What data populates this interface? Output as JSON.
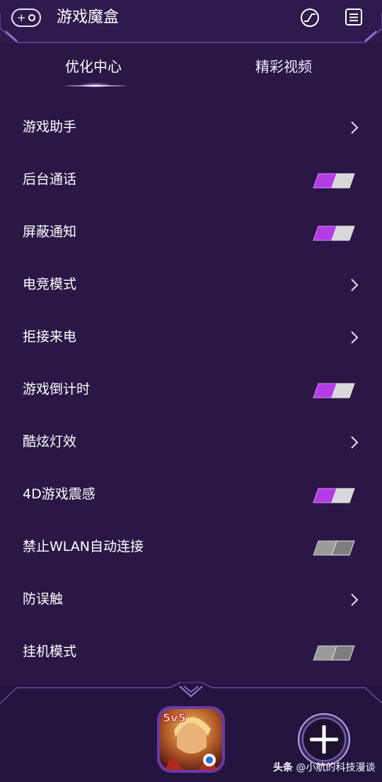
{
  "header": {
    "title": "游戏魔盒"
  },
  "tabs": [
    {
      "label": "优化中心",
      "active": true
    },
    {
      "label": "精彩视频",
      "active": false
    }
  ],
  "settings": [
    {
      "label": "游戏助手",
      "control": "chevron"
    },
    {
      "label": "后台通话",
      "control": "toggle",
      "on": true
    },
    {
      "label": "屏蔽通知",
      "control": "toggle",
      "on": true
    },
    {
      "label": "电竞模式",
      "control": "chevron"
    },
    {
      "label": "拒接来电",
      "control": "chevron"
    },
    {
      "label": "游戏倒计时",
      "control": "toggle",
      "on": true
    },
    {
      "label": "酷炫灯效",
      "control": "chevron"
    },
    {
      "label": "4D游戏震感",
      "control": "toggle",
      "on": true
    },
    {
      "label": "禁止WLAN自动连接",
      "control": "toggle",
      "on": false
    },
    {
      "label": "防误触",
      "control": "chevron"
    },
    {
      "label": "挂机模式",
      "control": "toggle",
      "on": false
    }
  ],
  "bottom": {
    "game_badge": "5v5",
    "watermark_source": "头条",
    "watermark_author": "@小航的科技漫谈"
  },
  "colors": {
    "background": "#2a1745",
    "toggle_on": "#b43ce6",
    "toggle_off": "#d8d8d8",
    "accent": "#c98bff"
  },
  "icons": {
    "logo": "gamepad-icon",
    "speed": "speed-icon",
    "list": "list-icon",
    "chevron": "chevron-right-icon",
    "add": "plus-icon"
  }
}
